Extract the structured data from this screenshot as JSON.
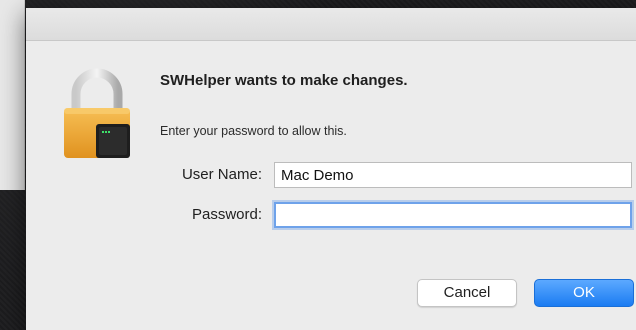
{
  "dialog": {
    "heading": "SWHelper wants to make changes.",
    "message": "Enter your password to allow this.",
    "icon": "lock-icon",
    "username": {
      "label": "User Name:",
      "value": "Mac Demo"
    },
    "password": {
      "label": "Password:",
      "value": ""
    },
    "buttons": {
      "cancel": "Cancel",
      "ok": "OK"
    }
  },
  "colors": {
    "accent": "#1b7cf2",
    "focus_ring": "#6ea2ea",
    "lock_gold": "#f0a93a"
  }
}
